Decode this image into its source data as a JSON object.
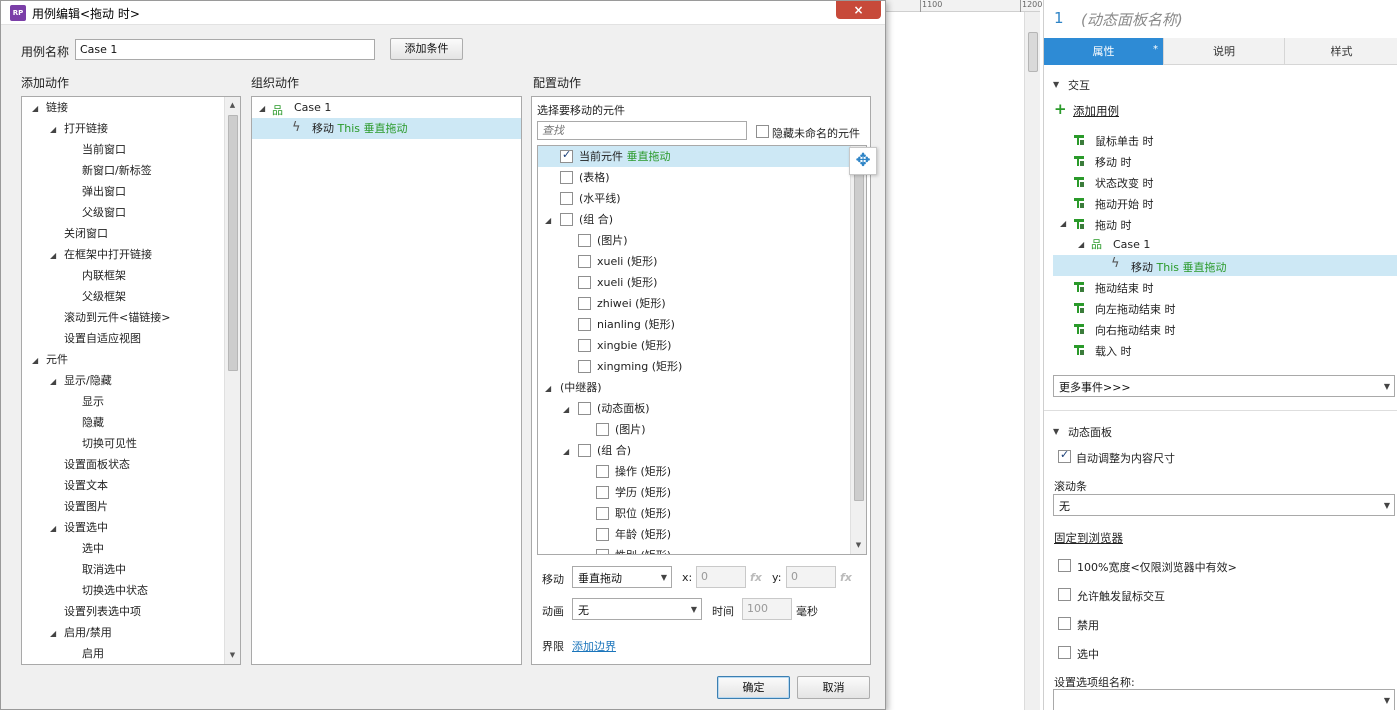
{
  "ruler": {
    "tick1": "1100",
    "tick2": "1200"
  },
  "dialog": {
    "title": "用例编辑<拖动 时>",
    "close_icon": "×",
    "case_name_label": "用例名称",
    "case_name_value": "Case 1",
    "add_condition": "添加条件",
    "add_action_header": "添加动作",
    "organize_header": "组织动作",
    "configure_header": "配置动作",
    "ok": "确定",
    "cancel": "取消"
  },
  "add_actions": [
    {
      "label": "链接",
      "level": 0,
      "expand": true
    },
    {
      "label": "打开链接",
      "level": 1,
      "expand": true
    },
    {
      "label": "当前窗口",
      "level": 2
    },
    {
      "label": "新窗口/新标签",
      "level": 2
    },
    {
      "label": "弹出窗口",
      "level": 2
    },
    {
      "label": "父级窗口",
      "level": 2
    },
    {
      "label": "关闭窗口",
      "level": 1
    },
    {
      "label": "在框架中打开链接",
      "level": 1,
      "expand": true
    },
    {
      "label": "内联框架",
      "level": 2
    },
    {
      "label": "父级框架",
      "level": 2
    },
    {
      "label": "滚动到元件<锚链接>",
      "level": 1
    },
    {
      "label": "设置自适应视图",
      "level": 1
    },
    {
      "label": "元件",
      "level": 0,
      "expand": true
    },
    {
      "label": "显示/隐藏",
      "level": 1,
      "expand": true
    },
    {
      "label": "显示",
      "level": 2
    },
    {
      "label": "隐藏",
      "level": 2
    },
    {
      "label": "切换可见性",
      "level": 2
    },
    {
      "label": "设置面板状态",
      "level": 1
    },
    {
      "label": "设置文本",
      "level": 1
    },
    {
      "label": "设置图片",
      "level": 1
    },
    {
      "label": "设置选中",
      "level": 1,
      "expand": true
    },
    {
      "label": "选中",
      "level": 2
    },
    {
      "label": "取消选中",
      "level": 2
    },
    {
      "label": "切换选中状态",
      "level": 2
    },
    {
      "label": "设置列表选中项",
      "level": 1
    },
    {
      "label": "启用/禁用",
      "level": 1,
      "expand": true
    },
    {
      "label": "启用",
      "level": 2
    }
  ],
  "organize": {
    "case_label": "Case 1",
    "action_prefix": "移动",
    "action_target": "This 垂直拖动"
  },
  "configure": {
    "select_label": "选择要移动的元件",
    "search_placeholder": "查找",
    "hide_unnamed": "隐藏未命名的元件",
    "widgets": [
      {
        "label": "当前元件",
        "extra": "垂直拖动",
        "level": 0,
        "checked": true,
        "selected": true
      },
      {
        "label": "(表格)",
        "level": 0
      },
      {
        "label": "(水平线)",
        "level": 0
      },
      {
        "label": "(组 合)",
        "level": 0,
        "expand": true
      },
      {
        "label": "(图片)",
        "level": 1
      },
      {
        "label": "xueli (矩形)",
        "level": 1
      },
      {
        "label": "xueli (矩形)",
        "level": 1
      },
      {
        "label": "zhiwei (矩形)",
        "level": 1
      },
      {
        "label": "nianling (矩形)",
        "level": 1
      },
      {
        "label": "xingbie (矩形)",
        "level": 1
      },
      {
        "label": "xingming (矩形)",
        "level": 1
      },
      {
        "label": "(中继器)",
        "level": 0,
        "expand": true,
        "nocb": true
      },
      {
        "label": "(动态面板)",
        "level": 1,
        "expand": true
      },
      {
        "label": "(图片)",
        "level": 2
      },
      {
        "label": "(组 合)",
        "level": 1,
        "expand": true
      },
      {
        "label": "操作 (矩形)",
        "level": 2
      },
      {
        "label": "学历 (矩形)",
        "level": 2
      },
      {
        "label": "职位 (矩形)",
        "level": 2
      },
      {
        "label": "年龄 (矩形)",
        "level": 2
      },
      {
        "label": "性别 (矩形)",
        "level": 2
      }
    ],
    "move_label": "移动",
    "move_value": "垂直拖动",
    "x_label": "x:",
    "x_value": "0",
    "y_label": "y:",
    "y_value": "0",
    "fx": "fx",
    "anim_label": "动画",
    "anim_value": "无",
    "time_label": "时间",
    "time_value": "100",
    "ms_label": "毫秒",
    "bounds_label": "界限",
    "add_bounds": "添加边界"
  },
  "inspector": {
    "number": "1",
    "title": "(动态面板名称)",
    "tabs": [
      "属性",
      "说明",
      "样式"
    ],
    "tab_star": "*",
    "interaction_header": "交互",
    "add_case": "添加用例",
    "events": [
      "鼠标单击 时",
      "移动 时",
      "状态改变 时",
      "拖动开始 时",
      "拖动 时"
    ],
    "case_label": "Case 1",
    "action_prefix": "移动",
    "action_target": "This 垂直拖动",
    "events_after": [
      "拖动结束 时",
      "向左拖动结束 时",
      "向右拖动结束 时",
      "载入 时"
    ],
    "more_events": "更多事件>>>",
    "panel_header": "动态面板",
    "auto_fit": "自动调整为内容尺寸",
    "scrollbar_label": "滚动条",
    "scrollbar_value": "无",
    "pin_browser": "固定到浏览器",
    "full_width": "100%宽度<仅限浏览器中有效>",
    "allow_mouse": "允许触发鼠标交互",
    "disable": "禁用",
    "select": "选中",
    "group_name_label": "设置选项组名称:"
  },
  "colors": {
    "accent": "#2e8bd5",
    "green": "#2a9a2a",
    "link": "#1b75bb",
    "selected": "#cde8f5"
  }
}
